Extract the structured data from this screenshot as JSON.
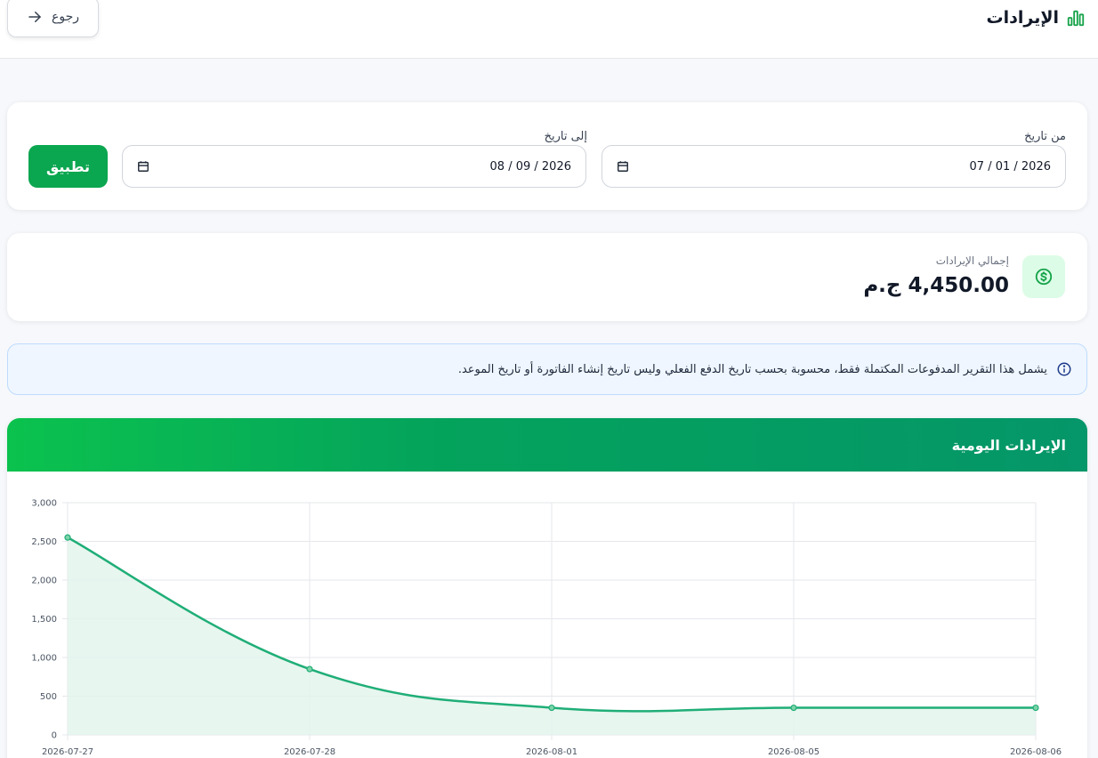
{
  "header": {
    "title": "الإيرادات",
    "back_label": "رجوع"
  },
  "filters": {
    "from_label": "من تاريخ",
    "from_value": "07 / 01 / 2026",
    "to_label": "إلى تاريخ",
    "to_value": "08 / 09 / 2026",
    "apply_label": "تطبيق"
  },
  "summary": {
    "label": "إجمالي الإيرادات",
    "amount": "4,450.00",
    "currency": "ج.م"
  },
  "info": {
    "text": "يشمل هذا التقرير المدفوعات المكتملة فقط، محسوبة بحسب تاريخ الدفع الفعلي وليس تاريخ إنشاء الفاتورة أو تاريخ الموعد."
  },
  "chart_section": {
    "title": "الإيرادات اليومية"
  },
  "colors": {
    "accent": "#0ba650",
    "line": "#1fae77",
    "fill": "#e3f5ec",
    "info_bg": "#eff6ff"
  },
  "chart_data": {
    "type": "area",
    "x": [
      "2026-07-27",
      "2026-07-28",
      "2026-08-01",
      "2026-08-05",
      "2026-08-06"
    ],
    "series": [
      {
        "values": [
          2550,
          850,
          350,
          350,
          350
        ]
      }
    ],
    "yticks": [
      "0",
      "500",
      "1,000",
      "1,500",
      "2,000",
      "2,500",
      "3,000"
    ],
    "ylim": [
      0,
      3000
    ],
    "grid": true
  }
}
